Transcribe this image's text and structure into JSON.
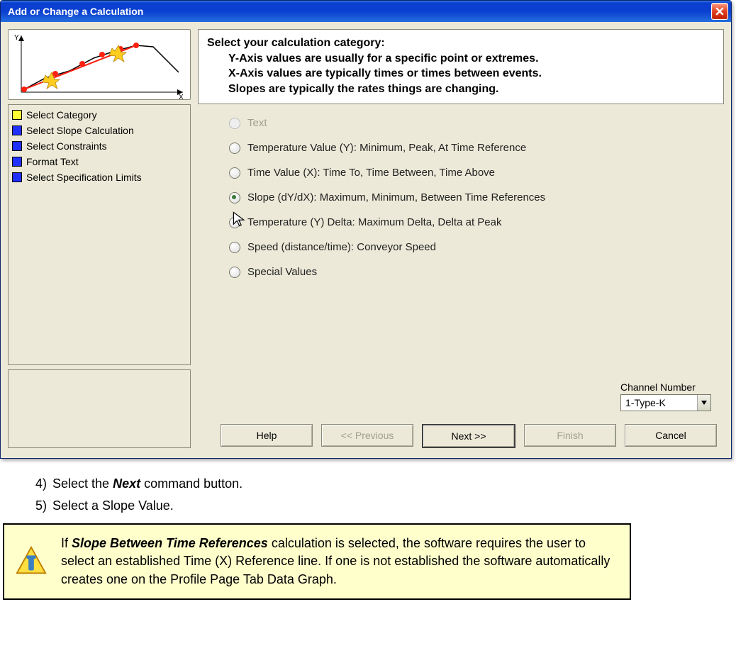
{
  "window": {
    "title": "Add or Change a Calculation"
  },
  "steps": [
    {
      "color": "yellow",
      "label": "Select Category"
    },
    {
      "color": "blue",
      "label": "Select Slope Calculation"
    },
    {
      "color": "blue",
      "label": "Select Constraints"
    },
    {
      "color": "blue",
      "label": "Format Text"
    },
    {
      "color": "blue",
      "label": "Select Specification Limits"
    }
  ],
  "heading": {
    "line1": "Select your calculation category:",
    "line2": "Y-Axis values are usually for a specific point or extremes.",
    "line3": "X-Axis values are typically times or times between events.",
    "line4": "Slopes are typically the rates things are changing."
  },
  "options": [
    {
      "label": "Text",
      "disabled": true,
      "selected": false
    },
    {
      "label": "Temperature Value (Y):  Minimum, Peak, At Time Reference",
      "disabled": false,
      "selected": false
    },
    {
      "label": "Time Value (X):  Time To, Time Between, Time Above",
      "disabled": false,
      "selected": false
    },
    {
      "label": "Slope (dY/dX):  Maximum, Minimum, Between Time References",
      "disabled": false,
      "selected": true
    },
    {
      "label": "Temperature (Y) Delta:  Maximum Delta, Delta at Peak",
      "disabled": false,
      "selected": false
    },
    {
      "label": "Speed (distance/time): Conveyor Speed",
      "disabled": false,
      "selected": false
    },
    {
      "label": "Special  Values",
      "disabled": false,
      "selected": false
    }
  ],
  "channel": {
    "label": "Channel Number",
    "value": "1-Type-K"
  },
  "buttons": {
    "help": "Help",
    "prev": "<< Previous",
    "next": "Next >>",
    "finish": "Finish",
    "cancel": "Cancel"
  },
  "doc_steps": {
    "s4_num": "4)",
    "s4_a": "Select the",
    "s4_b": "Next",
    "s4_c": "command button.",
    "s5_num": "5)",
    "s5": "Select a Slope Value."
  },
  "tip": {
    "a": "If",
    "b": "Slope Between Time References",
    "c": "calculation is selected, the software requires the user to select an established Time (X) Reference line. If one is not established the software automatically creates one on the Profile Page Tab Data Graph."
  }
}
